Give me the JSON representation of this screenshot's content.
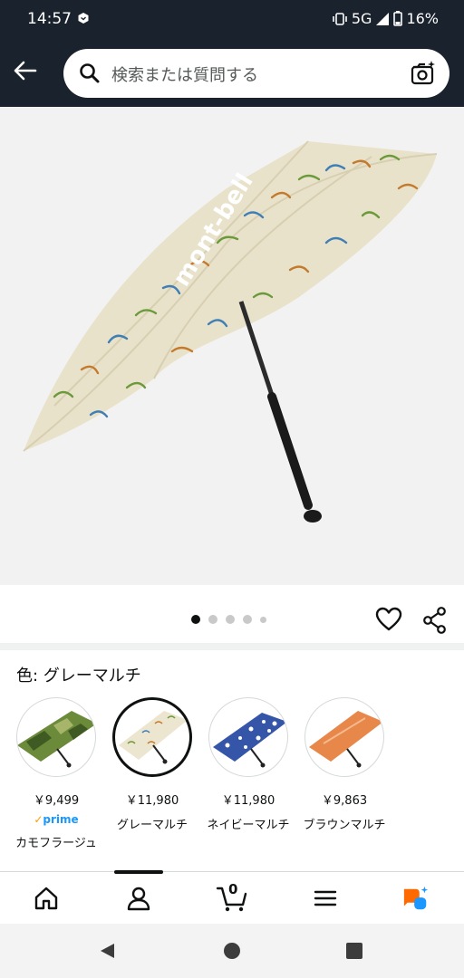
{
  "status_bar": {
    "time": "14:57",
    "network": "5G",
    "battery": "16%",
    "icons": [
      "notification-icon",
      "vibrate-icon",
      "signal-icon",
      "battery-icon"
    ]
  },
  "header": {
    "back_icon": "arrow-left-icon",
    "search_placeholder": "検索または質問する",
    "search_icon": "search-icon",
    "camera_icon": "camera-search-icon"
  },
  "product": {
    "image_count": 5,
    "active_image": 1,
    "brand_text": "mont-bell"
  },
  "actions": {
    "wishlist_icon": "heart-icon",
    "share_icon": "share-icon"
  },
  "color_selector": {
    "label": "色: グレーマルチ",
    "swatches": [
      {
        "price": "￥9,499",
        "prime": "prime",
        "name": "カモフラージュ",
        "color": "#6b8a3a",
        "selected": false
      },
      {
        "price": "￥11,980",
        "prime": "",
        "name": "グレーマルチ",
        "color": "#ece5cf",
        "selected": true
      },
      {
        "price": "￥11,980",
        "prime": "",
        "name": "ネイビーマルチ",
        "color": "#3556a8",
        "selected": false
      },
      {
        "price": "￥9,863",
        "prime": "",
        "name": "ブラウンマルチ",
        "color": "#e8874a",
        "selected": false
      }
    ]
  },
  "bottom_nav": {
    "items": [
      "home-icon",
      "account-icon",
      "cart-icon",
      "menu-icon",
      "ai-assistant-icon"
    ],
    "cart_count": "0"
  },
  "colors": {
    "header_bg": "#1a222d",
    "text": "#0f1111",
    "prime_blue": "#1a98ff",
    "prime_check": "#ff9900",
    "assistant_orange": "#ff6a00",
    "assistant_blue": "#1a98ff"
  }
}
